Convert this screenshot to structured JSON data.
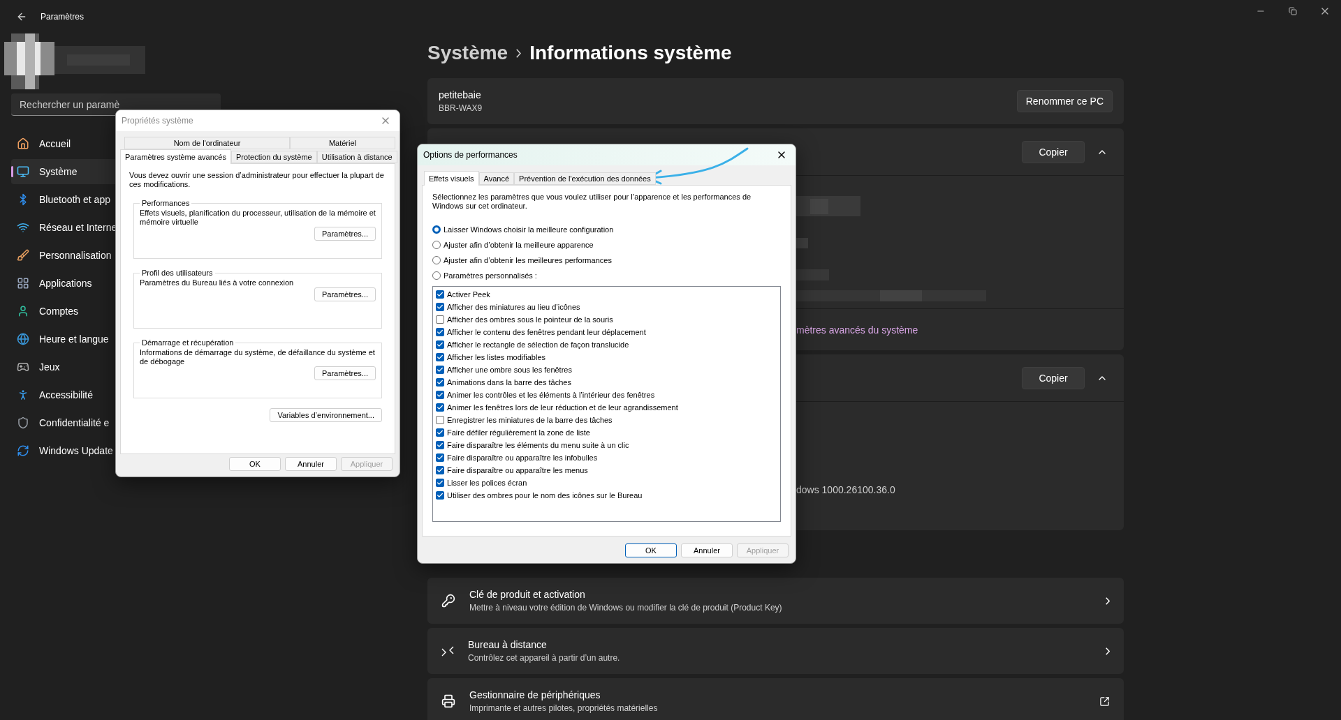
{
  "window": {
    "title": "Paramètres"
  },
  "search": {
    "placeholder": "Rechercher un paramè"
  },
  "sidebar": {
    "items": [
      {
        "label": "Accueil",
        "selected": false
      },
      {
        "label": "Système",
        "selected": true
      },
      {
        "label": "Bluetooth et app",
        "selected": false
      },
      {
        "label": "Réseau et Interne",
        "selected": false
      },
      {
        "label": "Personnalisation",
        "selected": false
      },
      {
        "label": "Applications",
        "selected": false
      },
      {
        "label": "Comptes",
        "selected": false
      },
      {
        "label": "Heure et langue",
        "selected": false
      },
      {
        "label": "Jeux",
        "selected": false
      },
      {
        "label": "Accessibilité",
        "selected": false
      },
      {
        "label": "Confidentialité e",
        "selected": false
      },
      {
        "label": "Windows Update",
        "selected": false
      }
    ]
  },
  "breadcrumb": {
    "parent": "Système",
    "current": "Informations système"
  },
  "device_card": {
    "name": "petitebaie",
    "model": "BBR-WAX9",
    "button": "Renommer ce PC"
  },
  "spec_sections": [
    {
      "kind": "device",
      "button": "Copier",
      "expanded": true,
      "link": "mètres avancés du système"
    },
    {
      "kind": "windows",
      "button": "Copier",
      "expanded": true,
      "text": "dows 1000.26100.36.0"
    }
  ],
  "related_links": [
    {
      "title": "Clé de produit et activation",
      "subtitle": "Mettre à niveau votre édition de Windows ou modifier la clé de produit (Product Key)"
    },
    {
      "title": "Bureau à distance",
      "subtitle": "Contrôlez cet appareil à partir d’un autre."
    },
    {
      "title": "Gestionnaire de périphériques",
      "subtitle": "Imprimante et autres pilotes, propriétés matérielles"
    }
  ],
  "system_properties": {
    "title": "Propriétés système",
    "tabs_back": [
      {
        "label": "Nom de l'ordinateur",
        "selected": false
      },
      {
        "label": "Matériel",
        "selected": false
      }
    ],
    "tabs_front": [
      {
        "label": "Paramètres système avancés",
        "selected": true
      },
      {
        "label": "Protection du système",
        "selected": false
      },
      {
        "label": "Utilisation à distance",
        "selected": false
      }
    ],
    "notice": "Vous devez ouvrir une session d’administrateur pour effectuer la plupart de ces modifications.",
    "groups": [
      {
        "title": "Performances",
        "description": "Effets visuels, planification du processeur, utilisation de la mémoire et mémoire virtuelle",
        "button": "Paramètres..."
      },
      {
        "title": "Profil des utilisateurs",
        "description": "Paramètres du Bureau liés à votre connexion",
        "button": "Paramètres..."
      },
      {
        "title": "Démarrage et récupération",
        "description": "Informations de démarrage du système, de défaillance du système et de débogage",
        "button": "Paramètres..."
      }
    ],
    "env_button": "Variables d’environnement...",
    "buttons": [
      {
        "label": "OK",
        "disabled": false
      },
      {
        "label": "Annuler",
        "disabled": false
      },
      {
        "label": "Appliquer",
        "disabled": true
      }
    ]
  },
  "performance_options": {
    "title": "Options de performances",
    "tabs": [
      {
        "label": "Effets visuels",
        "selected": true
      },
      {
        "label": "Avancé",
        "selected": false
      },
      {
        "label": "Prévention de l'exécution des données",
        "selected": false
      }
    ],
    "intro": "Sélectionnez les paramètres que vous voulez utiliser pour l’apparence et les performances de Windows sur cet ordinateur.",
    "radios": [
      {
        "label": "Laisser Windows choisir la meilleure configuration",
        "selected": true
      },
      {
        "label": "Ajuster afin d’obtenir la meilleure apparence",
        "selected": false
      },
      {
        "label": "Ajuster afin d’obtenir les meilleures performances",
        "selected": false
      },
      {
        "label": "Paramètres personnalisés :",
        "selected": false
      }
    ],
    "effects": [
      {
        "label": "Activer Peek",
        "checked": true
      },
      {
        "label": "Afficher des miniatures au lieu d’icônes",
        "checked": true
      },
      {
        "label": "Afficher des ombres sous le pointeur de la souris",
        "checked": false
      },
      {
        "label": "Afficher le contenu des fenêtres pendant leur déplacement",
        "checked": true
      },
      {
        "label": "Afficher le rectangle de sélection de façon translucide",
        "checked": true
      },
      {
        "label": "Afficher les listes modifiables",
        "checked": true
      },
      {
        "label": "Afficher une ombre sous les fenêtres",
        "checked": true
      },
      {
        "label": "Animations dans la barre des tâches",
        "checked": true
      },
      {
        "label": "Animer les contrôles et les éléments à l’intérieur des fenêtres",
        "checked": true
      },
      {
        "label": "Animer les fenêtres lors de leur réduction et de leur agrandissement",
        "checked": true
      },
      {
        "label": "Enregistrer les miniatures de la barre des tâches",
        "checked": false
      },
      {
        "label": "Faire défiler régulièrement la zone de liste",
        "checked": true
      },
      {
        "label": "Faire disparaître les éléments du menu suite à un clic",
        "checked": true
      },
      {
        "label": "Faire disparaître ou apparaître les infobulles",
        "checked": true
      },
      {
        "label": "Faire disparaître ou apparaître les menus",
        "checked": true
      },
      {
        "label": "Lisser les polices écran",
        "checked": true
      },
      {
        "label": "Utiliser des ombres pour le nom des icônes sur le Bureau",
        "checked": true
      }
    ],
    "buttons": [
      {
        "label": "OK",
        "disabled": false,
        "default": true
      },
      {
        "label": "Annuler",
        "disabled": false,
        "default": false
      },
      {
        "label": "Appliquer",
        "disabled": true,
        "default": false
      }
    ]
  }
}
